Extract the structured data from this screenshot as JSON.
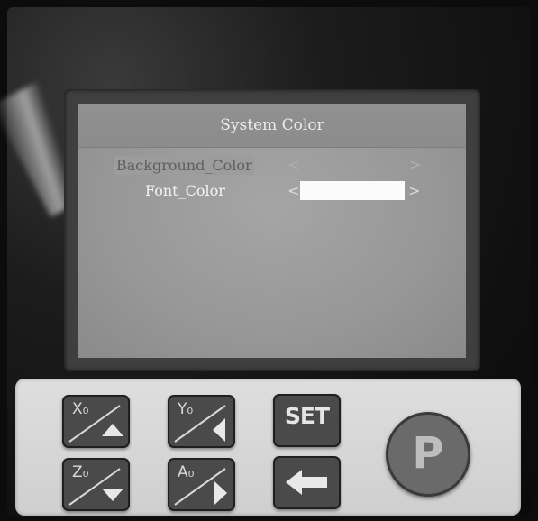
{
  "screen": {
    "title": "System Color",
    "menu": [
      {
        "label": "Background_Color",
        "left_arrow": "<",
        "right_arrow": ">"
      },
      {
        "label": "Font_Color",
        "left_arrow": "<",
        "right_arrow": ">"
      }
    ]
  },
  "keypad": {
    "x0": {
      "sub": "X₀",
      "icon": "arrow-up-icon"
    },
    "y0": {
      "sub": "Y₀",
      "icon": "arrow-left-icon"
    },
    "set": {
      "label": "SET"
    },
    "z0": {
      "sub": "Z₀",
      "icon": "arrow-down-icon"
    },
    "a0": {
      "sub": "A₀",
      "icon": "arrow-right-icon"
    },
    "back": {
      "icon": "back-arrow-icon"
    },
    "p": {
      "label": "P"
    }
  }
}
